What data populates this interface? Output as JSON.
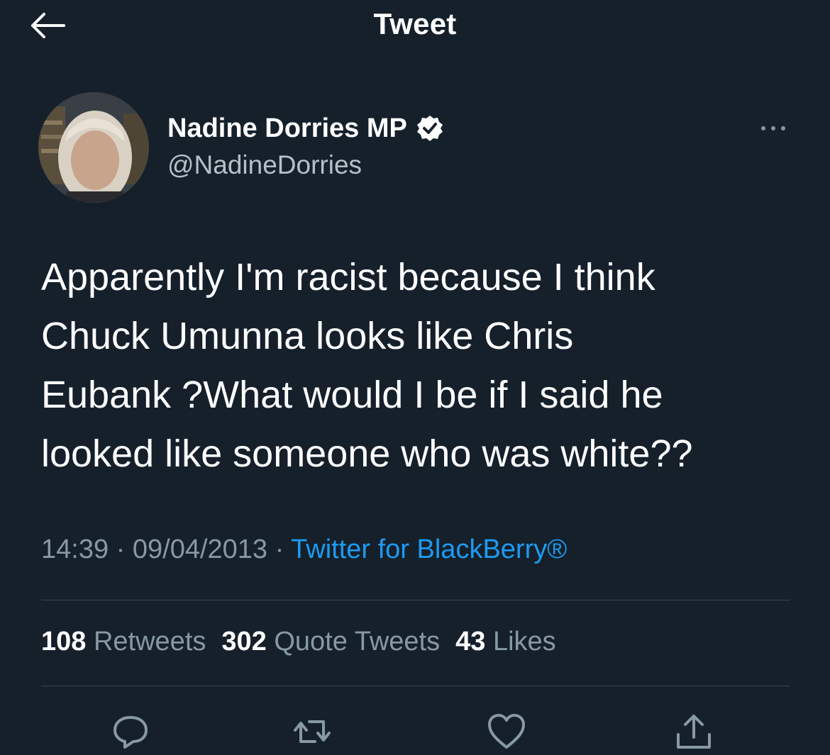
{
  "header": {
    "title": "Tweet",
    "back_icon": "arrow-left-icon"
  },
  "tweet": {
    "author": {
      "display_name": "Nadine Dorries MP",
      "handle": "@NadineDorries",
      "verified_icon": "verified-badge-icon"
    },
    "text": "Apparently I'm racist because I think\nChuck Umunna looks like Chris\nEubank ?What would I be if I said he\nlooked like someone who was white??",
    "time": "14:39",
    "separator1": " · ",
    "date": "09/04/2013",
    "separator2": " · ",
    "source": "Twitter for BlackBerry®",
    "stats": {
      "retweets_count": "108",
      "retweets_label": "Retweets",
      "quotes_count": "302",
      "quotes_label": "Quote Tweets",
      "likes_count": "43",
      "likes_label": "Likes"
    }
  },
  "actions": [
    "reply-icon",
    "retweet-icon",
    "like-icon",
    "share-icon"
  ],
  "colors": {
    "background": "#15202b",
    "text_primary": "#ffffff",
    "text_secondary": "#8899a6",
    "accent": "#1d9bf0",
    "divider": "#38444d"
  }
}
